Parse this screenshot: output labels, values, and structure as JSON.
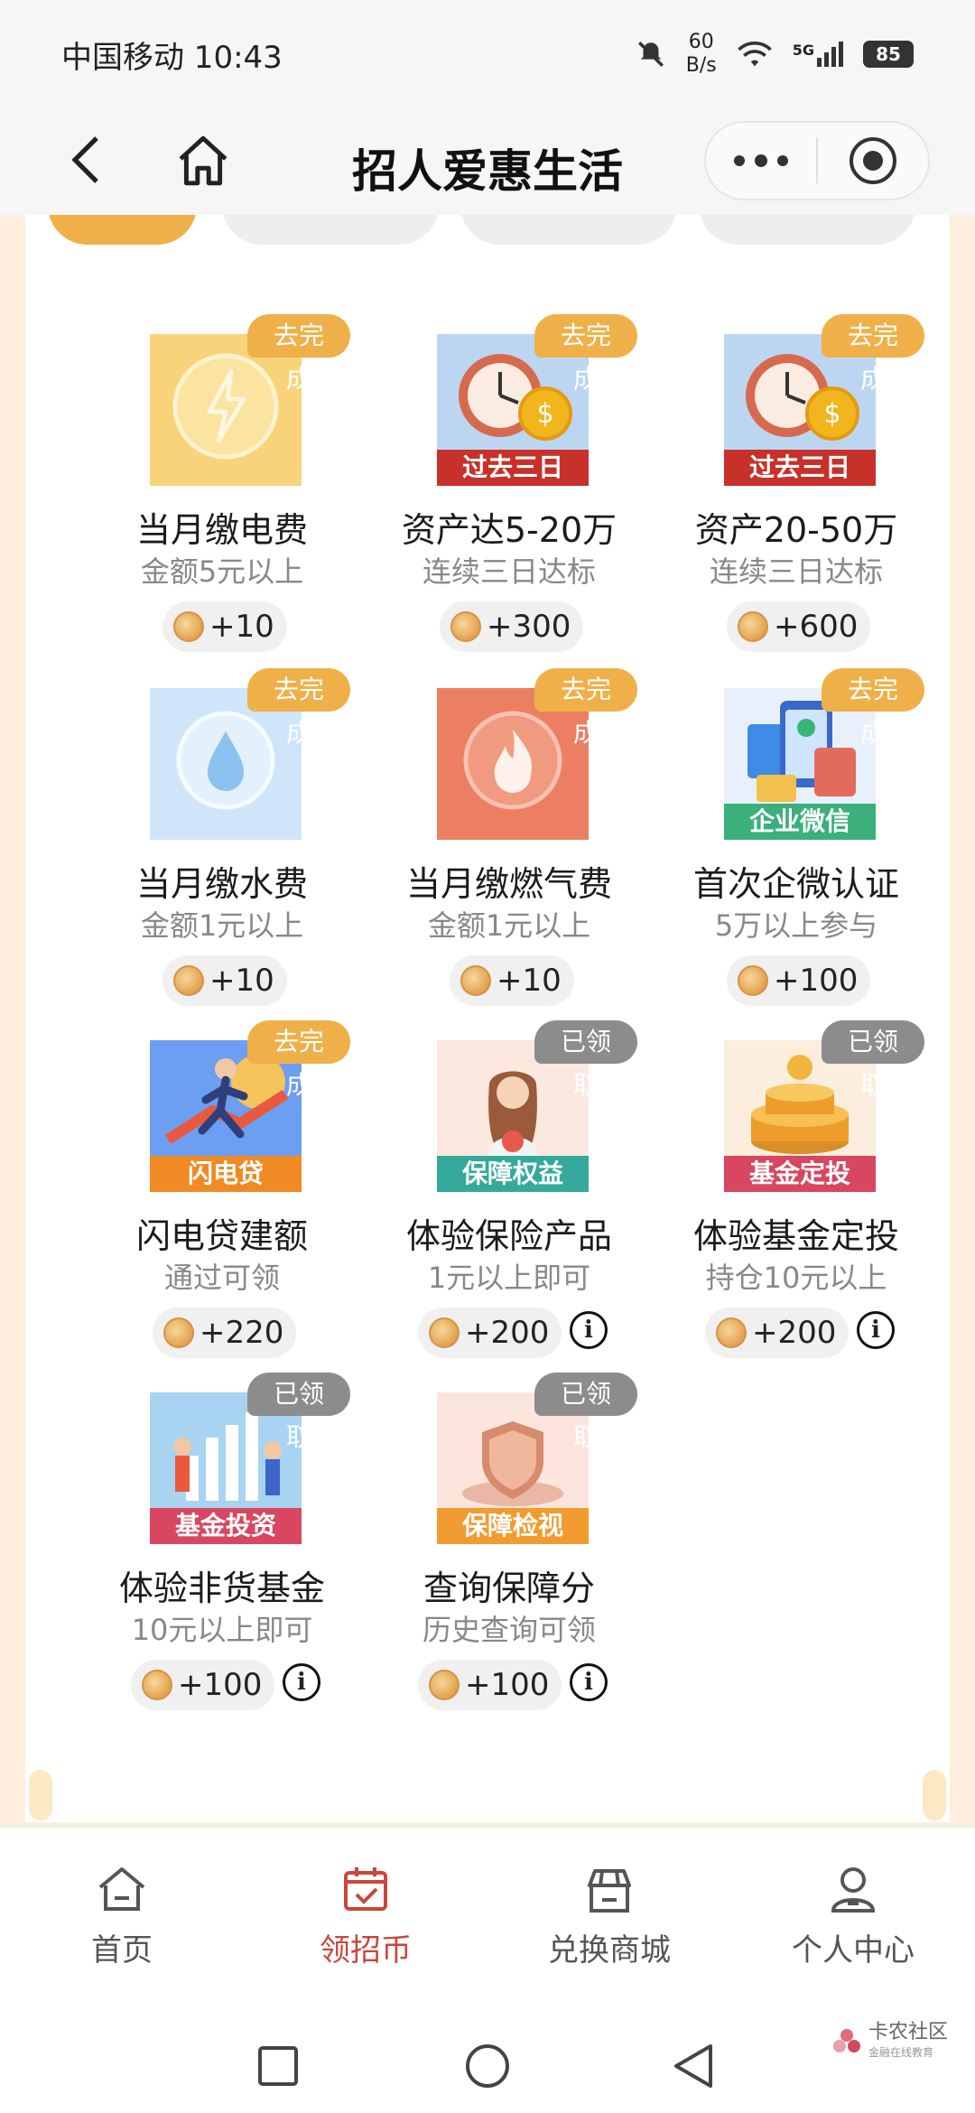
{
  "status_bar": {
    "carrier_time": "中国移动 10:43",
    "net_speed_value": "60",
    "net_speed_unit": "B/s",
    "signal": "5G",
    "battery": "85"
  },
  "header": {
    "title": "招人爱惠生活"
  },
  "tasks": [
    {
      "name": "当月缴电费",
      "sub": "金额5元以上",
      "reward": "+10",
      "status": "去完成",
      "thumb_label": "",
      "icon": "lightning-icon",
      "info": false
    },
    {
      "name": "资产达5-20万",
      "sub": "连续三日达标",
      "reward": "+300",
      "status": "去完成",
      "thumb_label": "过去三日",
      "icon": "clock-coin-icon",
      "info": false
    },
    {
      "name": "资产20-50万",
      "sub": "连续三日达标",
      "reward": "+600",
      "status": "去完成",
      "thumb_label": "过去三日",
      "icon": "clock-coin-icon",
      "info": false
    },
    {
      "name": "当月缴水费",
      "sub": "金额1元以上",
      "reward": "+10",
      "status": "去完成",
      "thumb_label": "",
      "icon": "water-drop-icon",
      "info": false
    },
    {
      "name": "当月缴燃气费",
      "sub": "金额1元以上",
      "reward": "+10",
      "status": "去完成",
      "thumb_label": "",
      "icon": "flame-icon",
      "info": false
    },
    {
      "name": "首次企微认证",
      "sub": "5万以上参与",
      "reward": "+100",
      "status": "去完成",
      "thumb_label": "企业微信",
      "icon": "wechat-work-icon",
      "info": false
    },
    {
      "name": "闪电贷建额",
      "sub": "通过可领",
      "reward": "+220",
      "status": "去完成",
      "thumb_label": "闪电贷",
      "icon": "running-man-icon",
      "info": false
    },
    {
      "name": "体验保险产品",
      "sub": "1元以上即可",
      "reward": "+200",
      "status": "已领取",
      "thumb_label": "保障权益",
      "icon": "woman-insurance-icon",
      "info": true
    },
    {
      "name": "体验基金定投",
      "sub": "持仓10元以上",
      "reward": "+200",
      "status": "已领取",
      "thumb_label": "基金定投",
      "icon": "coin-stack-icon",
      "info": true
    },
    {
      "name": "体验非货基金",
      "sub": "10元以上即可",
      "reward": "+100",
      "status": "已领取",
      "thumb_label": "基金投资",
      "icon": "chart-people-icon",
      "info": true
    },
    {
      "name": "查询保障分",
      "sub": "历史查询可领",
      "reward": "+100",
      "status": "已领取",
      "thumb_label": "保障检视",
      "icon": "shield-icon",
      "info": true
    }
  ],
  "colors": {
    "todo_badge": "#f0b049",
    "done_badge": "#8c8c8c",
    "label_red": "#c8302a",
    "label_green": "#3bb07a",
    "label_orange": "#f08a24",
    "label_teal": "#35a99b",
    "label_pink": "#d8465f",
    "label_amber": "#f29b30",
    "active_tab": "#c8473a"
  },
  "tabbar": {
    "items": [
      {
        "label": "首页",
        "icon": "home-icon"
      },
      {
        "label": "领招币",
        "icon": "calendar-check-icon"
      },
      {
        "label": "兑换商城",
        "icon": "store-icon"
      },
      {
        "label": "个人中心",
        "icon": "person-icon"
      }
    ]
  },
  "watermark": {
    "text": "卡农社区",
    "sub": "金融在线教育"
  }
}
